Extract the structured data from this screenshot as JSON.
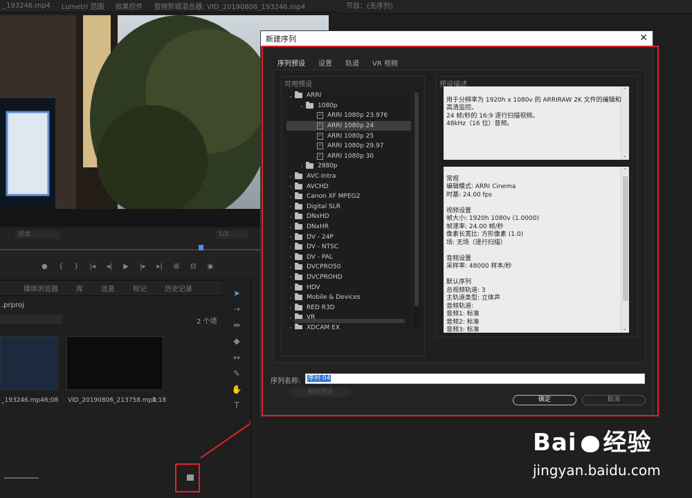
{
  "top_tabs": [
    "_193246.mp4",
    "Lumetri 范围",
    "效果控件",
    "音频剪辑混合器: VID_20190806_193246.mp4",
    "节目：(无序列)"
  ],
  "player": {
    "zoom": "适合",
    "quality": "1/2"
  },
  "project": {
    "tabs": [
      "媒体浏览器",
      "库",
      "信息",
      "标记",
      "历史记录"
    ],
    "name": ".prproj",
    "count": "2 个项",
    "items": [
      {
        "name": "_193246.mp4",
        "duration": "6;08"
      },
      {
        "name": "VID_20190806_213758.mp4",
        "duration": "5;18"
      }
    ]
  },
  "dialog": {
    "title": "新建序列",
    "close": "✕",
    "tabs": [
      "序列预设",
      "设置",
      "轨道",
      "VR 视频"
    ],
    "available_presets_label": "可用预设",
    "preset_description_label": "预设描述",
    "tree": [
      {
        "level": 0,
        "expanded": true,
        "type": "folder",
        "label": "ARRI"
      },
      {
        "level": 1,
        "expanded": true,
        "type": "folder",
        "label": "1080p"
      },
      {
        "level": 2,
        "type": "file",
        "label": "ARRI 1080p 23.976"
      },
      {
        "level": 2,
        "type": "file",
        "label": "ARRI 1080p 24",
        "selected": true
      },
      {
        "level": 2,
        "type": "file",
        "label": "ARRI 1080p 25"
      },
      {
        "level": 2,
        "type": "file",
        "label": "ARRI 1080p 29.97"
      },
      {
        "level": 2,
        "type": "file",
        "label": "ARRI 1080p 30"
      },
      {
        "level": 1,
        "expanded": false,
        "type": "folder",
        "label": "2880p"
      },
      {
        "level": 0,
        "expanded": false,
        "type": "folder",
        "label": "AVC-Intra"
      },
      {
        "level": 0,
        "expanded": false,
        "type": "folder",
        "label": "AVCHD"
      },
      {
        "level": 0,
        "expanded": false,
        "type": "folder",
        "label": "Canon XF MPEG2"
      },
      {
        "level": 0,
        "expanded": false,
        "type": "folder",
        "label": "Digital SLR"
      },
      {
        "level": 0,
        "expanded": false,
        "type": "folder",
        "label": "DNxHD"
      },
      {
        "level": 0,
        "expanded": false,
        "type": "folder",
        "label": "DNxHR"
      },
      {
        "level": 0,
        "expanded": false,
        "type": "folder",
        "label": "DV - 24P"
      },
      {
        "level": 0,
        "expanded": false,
        "type": "folder",
        "label": "DV - NTSC"
      },
      {
        "level": 0,
        "expanded": false,
        "type": "folder",
        "label": "DV - PAL"
      },
      {
        "level": 0,
        "expanded": false,
        "type": "folder",
        "label": "DVCPRO50"
      },
      {
        "level": 0,
        "expanded": false,
        "type": "folder",
        "label": "DVCPROHD"
      },
      {
        "level": 0,
        "expanded": false,
        "type": "folder",
        "label": "HDV"
      },
      {
        "level": 0,
        "expanded": false,
        "type": "folder",
        "label": "Mobile & Devices"
      },
      {
        "level": 0,
        "expanded": false,
        "type": "folder",
        "label": "RED R3D"
      },
      {
        "level": 0,
        "expanded": false,
        "type": "folder",
        "label": "VR"
      },
      {
        "level": 0,
        "expanded": false,
        "type": "folder",
        "label": "XDCAM EX"
      }
    ],
    "description": "用于分辨率为 1920h x 1080v 的 ARRIRAW 2K 文件的编辑和高清监控。\n24 帧/秒的 16:9 逐行扫描视频。\n48kHz（16 位）音频。",
    "details": "常规\n 编辑模式: ARRI Cinema\n 时基: 24.00 fps\n\n视频设置\n 帧大小: 1920h 1080v (1.0000)\n 帧速率: 24.00 帧/秒\n 像素长宽比: 方形像素 (1.0)\n 场: 无场（逐行扫描）\n\n音频设置\n 采样率: 48000 样本/秒\n\n默认序列\n 总视频轨道: 3\n 主轨道类型: 立体声\n 音频轨道:\n 音频1: 标准\n 音频2: 标准\n 音频3: 标准",
    "delete_preset": "删除预设",
    "sequence_name_label": "序列名称:",
    "sequence_name_value": "序列 04",
    "ok": "确定",
    "cancel": "取消"
  },
  "watermark": {
    "brand": "Bai",
    "brand_cn": "经验",
    "url": "jingyan.baidu.com"
  },
  "colors": {
    "highlight_red": "#e0242b",
    "selection_blue": "#2b6fd8"
  }
}
